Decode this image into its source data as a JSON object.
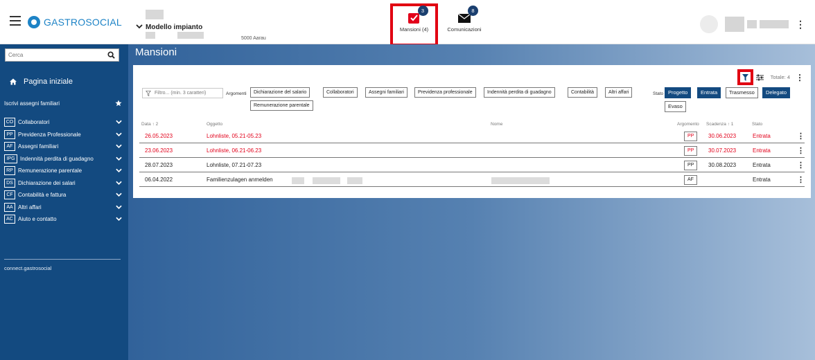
{
  "header": {
    "logo_text": "GASTROSOCIAL",
    "plant_name": "Modello impianto",
    "plant_city": "5000 Aarau",
    "tasks": {
      "label": "Mansioni (4)",
      "badge": "3"
    },
    "messages": {
      "label": "Comunicazioni",
      "badge": "8"
    }
  },
  "sidebar": {
    "search_placeholder": "Cerca",
    "home_label": "Pagina iniziale",
    "enroll_label": "Iscrivi assegni familiari",
    "items": [
      {
        "abbr": "CO",
        "label": "Collaboratori"
      },
      {
        "abbr": "PP",
        "label": "Previdenza Professionale"
      },
      {
        "abbr": "AF",
        "label": "Assegni familiari"
      },
      {
        "abbr": "IPG",
        "label": "Indennità perdita di guadagno"
      },
      {
        "abbr": "RP",
        "label": "Remunerazione parentale"
      },
      {
        "abbr": "DS",
        "label": "Dichiarazione dei salari"
      },
      {
        "abbr": "CF",
        "label": "Contabilità e fattura"
      },
      {
        "abbr": "AA",
        "label": "Altri affari"
      },
      {
        "abbr": "AC",
        "label": "Aiuto e contatto"
      }
    ],
    "footer_link": "connect.gastrosocial"
  },
  "main": {
    "title": "Mansioni",
    "filter_placeholder": "Filtro... (min. 3 caratteri)",
    "argomenti_label": "Argomenti",
    "topics": [
      "Dichiarazione del salario",
      "Collaboratori",
      "Assegni familiari",
      "Previdenza professionale",
      "Indennità perdita di guadagno",
      "Contabilità",
      "Altri affari",
      "Remunerazione parentale"
    ],
    "stato_label": "Stato",
    "statuses": [
      {
        "label": "Progetto",
        "active": true
      },
      {
        "label": "Entrata",
        "active": true
      },
      {
        "label": "Trasmesso",
        "active": false
      },
      {
        "label": "Delegato",
        "active": true
      },
      {
        "label": "Evaso",
        "active": false
      }
    ],
    "total_label": "Totale: 4",
    "columns": {
      "date": "Data ↑ 2",
      "subject": "Oggetto",
      "name": "Nome",
      "topic": "Argomento",
      "due": "Scadenza ↑ 1",
      "status": "Stato"
    },
    "rows": [
      {
        "date": "26.05.2023",
        "subject": "Lohnliste, 05.21-05.23",
        "topic": "PP",
        "due": "30.06.2023",
        "status": "Entrata",
        "overdue": true
      },
      {
        "date": "23.06.2023",
        "subject": "Lohnliste, 06.21-06.23",
        "topic": "PP",
        "due": "30.07.2023",
        "status": "Entrata",
        "overdue": true
      },
      {
        "date": "28.07.2023",
        "subject": "Lohnliste, 07.21-07.23",
        "topic": "PP",
        "due": "30.08.2023",
        "status": "Entrata",
        "overdue": false
      },
      {
        "date": "06.04.2022",
        "subject": "Familienzulagen anmelden",
        "topic": "AF",
        "due": "",
        "status": "Entrata",
        "overdue": false
      }
    ]
  },
  "colors": {
    "brand_blue": "#1d83c6",
    "sidebar": "#134a80",
    "overdue_red": "#e2001a",
    "highlight": "#e10011",
    "badge": "#1a3f6f"
  }
}
